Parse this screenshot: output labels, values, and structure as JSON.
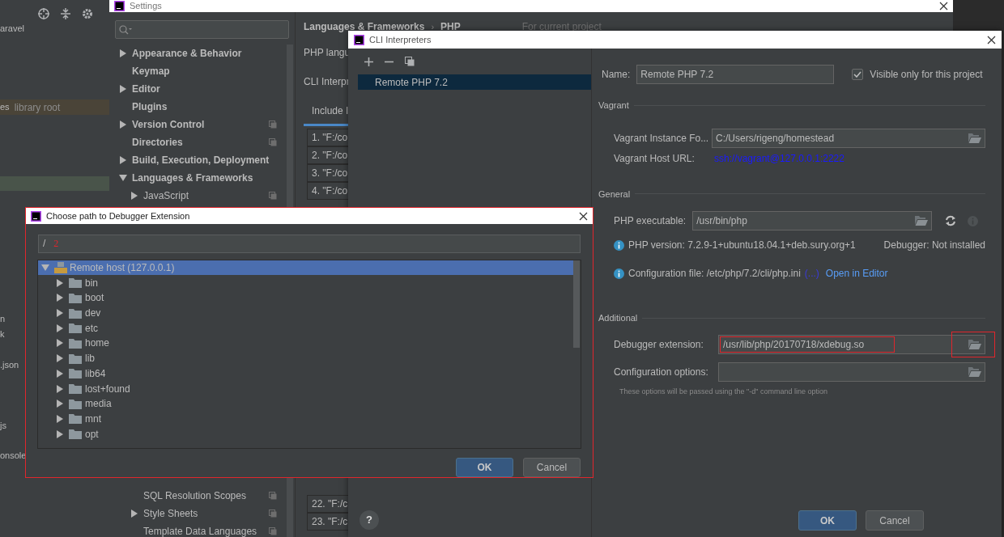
{
  "ide": {
    "project_lines": [
      {
        "text": "aravel",
        "kind": "plain"
      },
      {
        "text": "es",
        "kind": "library",
        "suffix": "library root"
      },
      {
        "text": "n",
        "kind": "plain"
      },
      {
        "text": "k",
        "kind": "plain"
      },
      {
        "text": ".json",
        "kind": "plain"
      },
      {
        "text": "js",
        "kind": "plain"
      },
      {
        "text": "onsole",
        "kind": "plain"
      }
    ]
  },
  "settings": {
    "title": "Settings",
    "tree": [
      {
        "label": "Appearance & Behavior",
        "expanded": false,
        "project_scoped": false
      },
      {
        "label": "Keymap",
        "project_scoped": false
      },
      {
        "label": "Editor",
        "expanded": false,
        "project_scoped": false
      },
      {
        "label": "Plugins",
        "project_scoped": false
      },
      {
        "label": "Version Control",
        "expanded": false,
        "project_scoped": true
      },
      {
        "label": "Directories",
        "project_scoped": true
      },
      {
        "label": "Build, Execution, Deployment",
        "expanded": false,
        "project_scoped": false
      },
      {
        "label": "Languages & Frameworks",
        "expanded": true,
        "project_scoped": false,
        "children": [
          {
            "label": "JavaScript",
            "expanded": false,
            "project_scoped": true
          }
        ],
        "lower_children": [
          {
            "label": "SQL Resolution Scopes",
            "project_scoped": true
          },
          {
            "label": "Style Sheets",
            "expanded": false,
            "project_scoped": true
          },
          {
            "label": "Template Data Languages",
            "project_scoped": true
          }
        ]
      }
    ],
    "breadcrumb": [
      "Languages & Frameworks",
      "PHP"
    ],
    "breadcrumb_separator": "›",
    "scope_note": "For current project",
    "labels": [
      "PHP langu",
      "CLI Interpr"
    ],
    "tab": {
      "label": "Include I",
      "selected": true
    },
    "include_rows_top": [
      "1. \"F:/co",
      "2. \"F:/co",
      "3. \"F:/co",
      "4. \"F:/co"
    ],
    "include_rows_bottom": [
      "22. \"F:/c",
      "23. \"F:/c"
    ],
    "help": "?"
  },
  "cli": {
    "title": "CLI Interpreters",
    "interpreters": [
      {
        "label": "Remote PHP 7.2",
        "selected": true
      }
    ],
    "name_label": "Name:",
    "name_value": "Remote PHP 7.2",
    "visible_only": {
      "label": "Visible only for this project",
      "checked": true
    },
    "vagrant": {
      "heading": "Vagrant",
      "instance_label": "Vagrant Instance Fo...",
      "instance_value": "C:/Users/rigeng/homestead",
      "host_label": "Vagrant Host URL:",
      "host_url": "ssh://vagrant@127.0.0.1:2222"
    },
    "general": {
      "heading": "General",
      "exe_label": "PHP executable:",
      "exe_value": "/usr/bin/php",
      "version": "PHP version: 7.2.9-1+ubuntu18.04.1+deb.sury.org+1",
      "debugger": "Debugger: Not installed",
      "config_file": "Configuration file: /etc/php/7.2/cli/php.ini",
      "config_more": "(...)",
      "open_link": "Open in Editor"
    },
    "additional": {
      "heading": "Additional",
      "ext_label": "Debugger extension:",
      "ext_value": "/usr/lib/php/20170718/xdebug.so",
      "ext_highlighted": true,
      "browse_highlighted": true,
      "opts_label": "Configuration options:",
      "hint": "These options will be passed using the \"-d\" command line option"
    },
    "buttons": [
      "OK",
      "Cancel"
    ]
  },
  "chooser": {
    "title": "Choose path to Debugger Extension",
    "highlighted": true,
    "path": "/",
    "path_annotation": "2",
    "tree": [
      {
        "label": "Remote host (127.0.0.1)",
        "selected": true,
        "expanded": true,
        "children": [
          {
            "label": "bin",
            "expanded": false,
            "selected": false
          },
          {
            "label": "boot",
            "expanded": false,
            "selected": false
          },
          {
            "label": "dev",
            "expanded": false,
            "selected": false
          },
          {
            "label": "etc",
            "expanded": false,
            "selected": false
          },
          {
            "label": "home",
            "expanded": false,
            "selected": false
          },
          {
            "label": "lib",
            "expanded": false,
            "selected": false
          },
          {
            "label": "lib64",
            "expanded": false,
            "selected": false
          },
          {
            "label": "lost+found",
            "expanded": false,
            "selected": false
          },
          {
            "label": "media",
            "expanded": false,
            "selected": false
          },
          {
            "label": "mnt",
            "expanded": false,
            "selected": false
          },
          {
            "label": "opt",
            "expanded": false,
            "selected": false
          }
        ]
      }
    ],
    "buttons": [
      "OK",
      "Cancel"
    ]
  }
}
